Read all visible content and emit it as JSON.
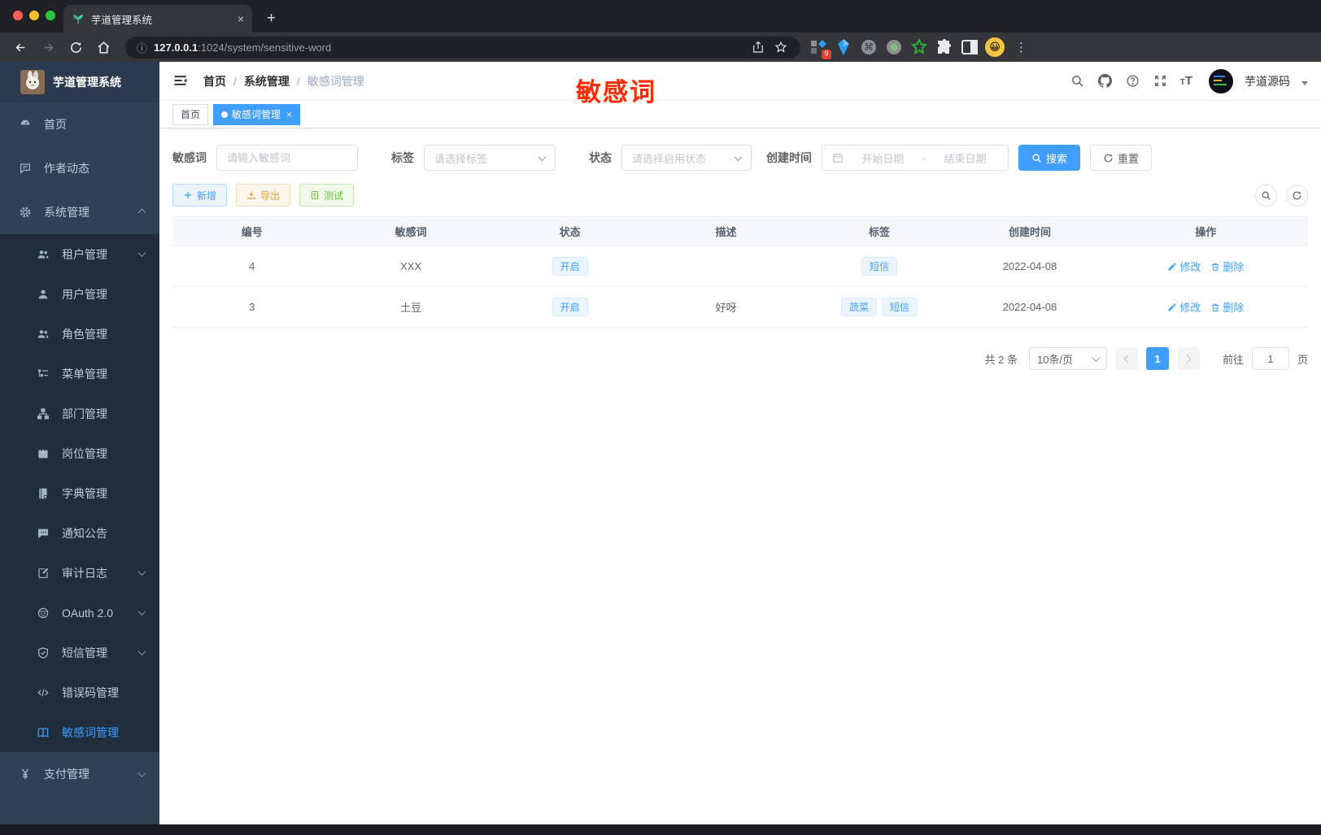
{
  "browser": {
    "tab_title": "芋道管理系统",
    "new_tab_label": "+",
    "url_host": "127.0.0.1",
    "url_path": ":1024/system/sensitive-word",
    "extension_badge": "9"
  },
  "sidebar": {
    "title": "芋道管理系统",
    "items": [
      {
        "id": "home",
        "icon": "dashboard",
        "label": "首页",
        "level": 0
      },
      {
        "id": "author-news",
        "icon": "chat",
        "label": "作者动态",
        "level": 0
      },
      {
        "id": "system",
        "icon": "gear",
        "label": "系统管理",
        "level": 0,
        "arrow": "up"
      },
      {
        "id": "tenant",
        "icon": "people",
        "label": "租户管理",
        "level": 1,
        "arrow": "down"
      },
      {
        "id": "user",
        "icon": "person",
        "label": "用户管理",
        "level": 1
      },
      {
        "id": "role",
        "icon": "people",
        "label": "角色管理",
        "level": 1
      },
      {
        "id": "menu",
        "icon": "treelist",
        "label": "菜单管理",
        "level": 1
      },
      {
        "id": "dept",
        "icon": "org",
        "label": "部门管理",
        "level": 1
      },
      {
        "id": "post",
        "icon": "badge",
        "label": "岗位管理",
        "level": 1
      },
      {
        "id": "dict",
        "icon": "dict",
        "label": "字典管理",
        "level": 1
      },
      {
        "id": "notice",
        "icon": "comment",
        "label": "通知公告",
        "level": 1
      },
      {
        "id": "audit-log",
        "icon": "log",
        "label": "审计日志",
        "level": 1,
        "arrow": "down"
      },
      {
        "id": "oauth",
        "icon": "robot",
        "label": "OAuth 2.0",
        "level": 1,
        "arrow": "down"
      },
      {
        "id": "sms",
        "icon": "shield",
        "label": "短信管理",
        "level": 1,
        "arrow": "down"
      },
      {
        "id": "error-code",
        "icon": "code",
        "label": "错误码管理",
        "level": 1
      },
      {
        "id": "sensitive-word",
        "icon": "openbook",
        "label": "敏感词管理",
        "level": 1,
        "active": true
      },
      {
        "id": "pay",
        "icon": "yen",
        "label": "支付管理",
        "level": 0,
        "arrow": "down"
      }
    ]
  },
  "navbar": {
    "breadcrumb": [
      "首页",
      "系统管理",
      "敏感词管理"
    ],
    "separator": "/",
    "username": "芋道源码"
  },
  "annotation": {
    "text": "敏感词",
    "color": "#fe2c00"
  },
  "tags_view": {
    "tabs": [
      {
        "label": "首页",
        "active": false
      },
      {
        "label": "敏感词管理",
        "active": true,
        "closable": true
      }
    ],
    "close_label": "×"
  },
  "filters": {
    "keyword": {
      "label": "敏感词",
      "placeholder": "请输入敏感词",
      "value": ""
    },
    "tag": {
      "label": "标签",
      "placeholder": "请选择标签"
    },
    "status": {
      "label": "状态",
      "placeholder": "请选择启用状态"
    },
    "date": {
      "label": "创建时间",
      "start_placeholder": "开始日期",
      "separator": "-",
      "end_placeholder": "结束日期"
    },
    "search_label": "搜索",
    "reset_label": "重置"
  },
  "toolbar": {
    "add_label": "新增",
    "export_label": "导出",
    "test_label": "测试"
  },
  "table": {
    "headers": [
      "编号",
      "敏感词",
      "状态",
      "描述",
      "标签",
      "创建时间",
      "操作"
    ],
    "rows": [
      {
        "id": "4",
        "word": "XXX",
        "status": "开启",
        "description": "",
        "tags": [
          "短信"
        ],
        "created_at": "2022-04-08"
      },
      {
        "id": "3",
        "word": "土豆",
        "status": "开启",
        "description": "好呀",
        "tags": [
          "蔬菜",
          "短信"
        ],
        "created_at": "2022-04-08"
      }
    ],
    "actions": {
      "edit": "修改",
      "delete": "删除"
    }
  },
  "pagination": {
    "total": "共 2 条",
    "page_size": "10条/页",
    "current": "1",
    "goto_label": "前往",
    "goto_value": "1",
    "unit_label": "页"
  },
  "colors": {
    "primary": "#409eff",
    "sidebar_bg": "#304156",
    "submenu_bg": "#1f2d3d"
  }
}
